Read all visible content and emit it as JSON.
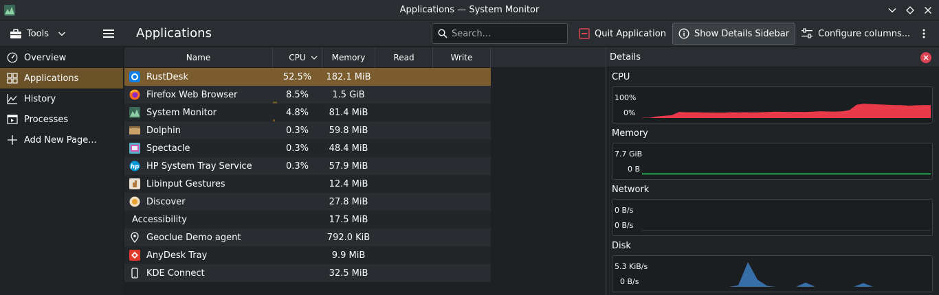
{
  "window": {
    "title": "Applications — System Monitor"
  },
  "toolbar": {
    "tools_label": "Tools",
    "page_title": "Applications",
    "search_placeholder": "Search...",
    "quit_label": "Quit Application",
    "details_label": "Show Details Sidebar",
    "configure_label": "Configure columns..."
  },
  "sidebar": {
    "items": [
      {
        "label": "Overview",
        "icon": "gauge-icon"
      },
      {
        "label": "Applications",
        "icon": "grid-icon",
        "selected": true
      },
      {
        "label": "History",
        "icon": "history-graph-icon"
      },
      {
        "label": "Processes",
        "icon": "process-window-icon"
      },
      {
        "label": "Add New Page...",
        "icon": "plus-icon"
      }
    ]
  },
  "table": {
    "columns": [
      "Name",
      "CPU",
      "Memory",
      "Read",
      "Write"
    ],
    "sort_column": "CPU",
    "rows": [
      {
        "name": "RustDesk",
        "cpu": "52.5%",
        "memory": "182.1 MiB",
        "cpu_fraction": 0.525,
        "icon": "rustdesk-icon",
        "selected": true
      },
      {
        "name": "Firefox Web Browser",
        "cpu": "8.5%",
        "memory": "1.5 GiB",
        "cpu_fraction": 0.085,
        "icon": "firefox-icon"
      },
      {
        "name": "System Monitor",
        "cpu": "4.8%",
        "memory": "81.4 MiB",
        "cpu_fraction": 0.048,
        "icon": "system-monitor-icon"
      },
      {
        "name": "Dolphin",
        "cpu": "0.3%",
        "memory": "59.8 MiB",
        "cpu_fraction": 0.003,
        "icon": "folder-icon"
      },
      {
        "name": "Spectacle",
        "cpu": "0.3%",
        "memory": "48.4 MiB",
        "cpu_fraction": 0.003,
        "icon": "spectacle-icon"
      },
      {
        "name": "HP System Tray Service",
        "cpu": "0.3%",
        "memory": "57.9 MiB",
        "cpu_fraction": 0.003,
        "icon": "hp-icon"
      },
      {
        "name": "Libinput Gestures",
        "cpu": "",
        "memory": "12.4 MiB",
        "cpu_fraction": 0,
        "icon": "gestures-icon"
      },
      {
        "name": "Discover",
        "cpu": "",
        "memory": "27.8 MiB",
        "cpu_fraction": 0,
        "icon": "discover-icon"
      },
      {
        "name": "Accessibility",
        "cpu": "",
        "memory": "17.5 MiB",
        "cpu_fraction": 0,
        "icon": ""
      },
      {
        "name": "Geoclue Demo agent",
        "cpu": "",
        "memory": "792.0 KiB",
        "cpu_fraction": 0,
        "icon": "location-pin-icon"
      },
      {
        "name": "AnyDesk Tray",
        "cpu": "",
        "memory": "9.9 MiB",
        "cpu_fraction": 0,
        "icon": "anydesk-icon"
      },
      {
        "name": "KDE Connect",
        "cpu": "",
        "memory": "32.5 MiB",
        "cpu_fraction": 0,
        "icon": "phone-icon"
      }
    ]
  },
  "details": {
    "title": "Details",
    "cpu": {
      "title": "CPU",
      "ymax_label": "100%",
      "ymin_label": "0%"
    },
    "memory": {
      "title": "Memory",
      "ymax_label": "7.7 GiB",
      "ymin_label": "0 B"
    },
    "network": {
      "title": "Network",
      "ymax_label": "0 B/s",
      "ymin_label": "0 B/s"
    },
    "disk": {
      "title": "Disk",
      "ymax_label": "5.3 KiB/s",
      "ymin_label": "0 B/s"
    }
  },
  "colors": {
    "accent": "#6b5228",
    "cpu_graph": "#e93a4a",
    "memory_graph": "#1cdc6a",
    "disk_graph": "#3d7dbf",
    "close": "#da4453"
  },
  "chart_data": [
    {
      "type": "area",
      "title": "CPU",
      "ylim": [
        0,
        100
      ],
      "x": [
        0,
        1,
        2,
        3,
        4,
        5,
        6,
        7,
        8,
        9,
        10,
        11,
        12,
        13,
        14,
        15,
        16,
        17,
        18,
        19,
        20,
        21,
        22,
        23,
        24,
        25,
        26,
        27,
        28,
        29,
        30,
        31,
        32,
        33,
        34,
        35,
        36,
        37,
        38,
        39
      ],
      "values": [
        2,
        2,
        10,
        15,
        18,
        40,
        38,
        38,
        37,
        36,
        36,
        35,
        38,
        37,
        38,
        37,
        38,
        40,
        42,
        41,
        40,
        41,
        40,
        42,
        45,
        43,
        42,
        44,
        52,
        88,
        95,
        92,
        90,
        88,
        86,
        85,
        82,
        84,
        86,
        85
      ]
    },
    {
      "type": "line",
      "title": "Memory",
      "x": [
        0,
        1
      ],
      "values": [
        0.02,
        0.02
      ]
    },
    {
      "type": "line",
      "title": "Network",
      "x": [
        0,
        1
      ],
      "values": [
        0,
        0
      ]
    },
    {
      "type": "area",
      "title": "Disk",
      "unit": "KiB/s",
      "x": [
        0,
        1,
        2,
        3,
        4,
        5,
        6,
        7,
        8,
        9,
        10,
        11,
        12,
        13,
        14,
        15,
        16,
        17,
        18,
        19,
        20,
        21,
        22,
        23,
        24,
        25,
        26,
        27,
        28,
        29,
        30
      ],
      "values": [
        0,
        0,
        0,
        0,
        0,
        0,
        0,
        0,
        0,
        0,
        0.3,
        5.3,
        1.5,
        0.2,
        0,
        0,
        0,
        0.9,
        0,
        0,
        0,
        0,
        0,
        0.8,
        0,
        0,
        0,
        0,
        0,
        0,
        0
      ]
    }
  ]
}
